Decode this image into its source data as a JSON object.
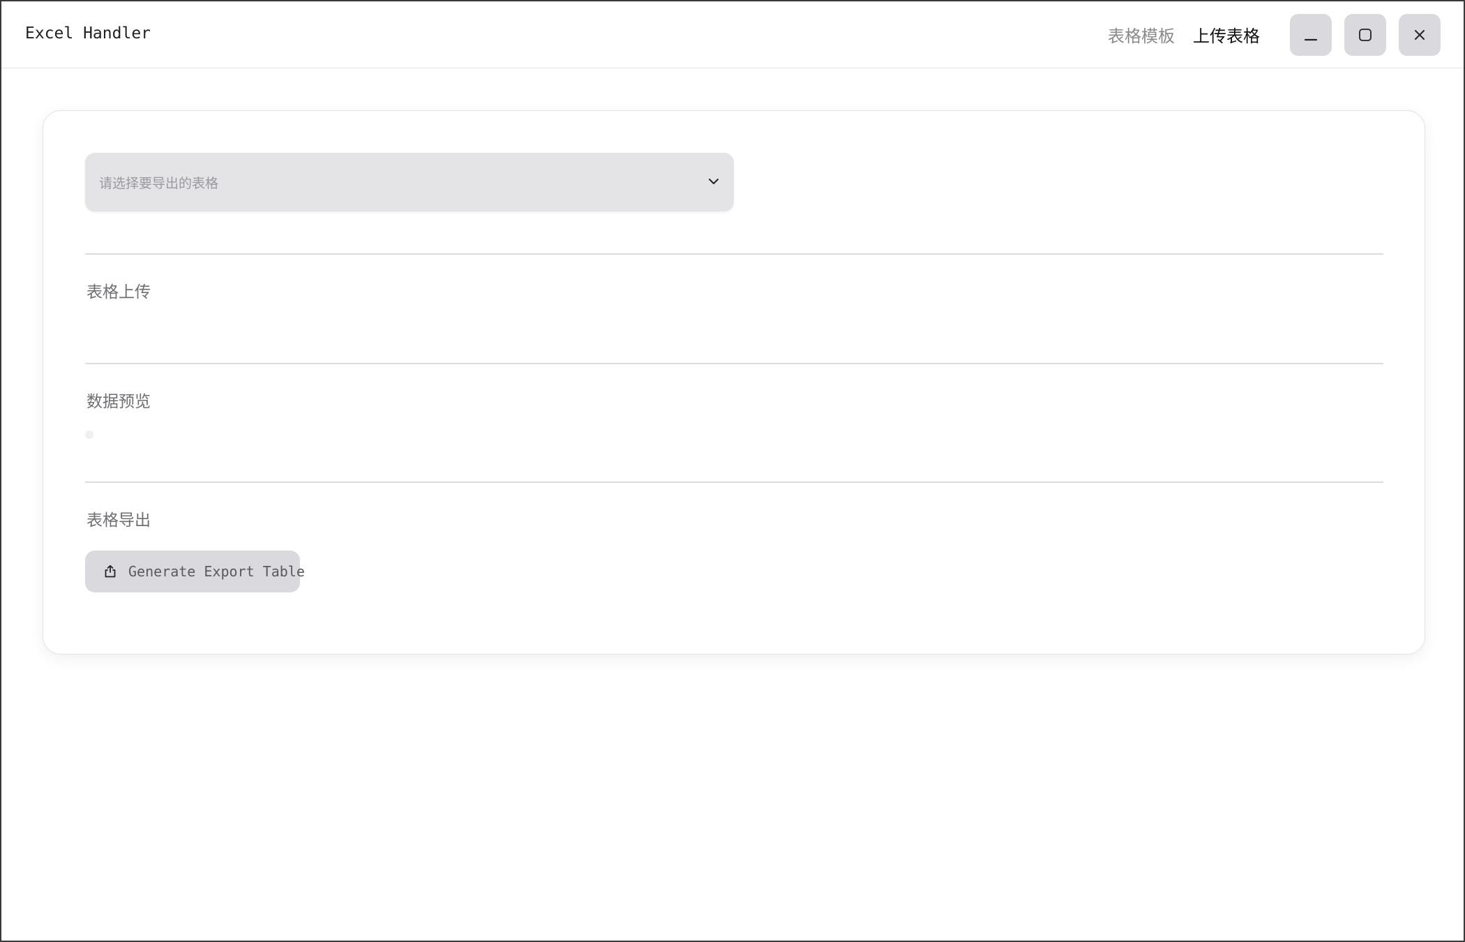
{
  "window": {
    "title": "Excel Handler",
    "nav": [
      {
        "label": "表格模板",
        "active": false
      },
      {
        "label": "上传表格",
        "active": true
      }
    ],
    "controls": {
      "minimize_icon": "minimize-icon",
      "maximize_icon": "maximize-icon",
      "close_icon": "close-icon"
    }
  },
  "main": {
    "table_select": {
      "placeholder": "请选择要导出的表格",
      "icon": "chevron-down-icon"
    },
    "sections": {
      "upload": {
        "label": "表格上传"
      },
      "preview": {
        "label": "数据预览"
      },
      "export": {
        "label": "表格导出",
        "button_label": "Generate Export Table",
        "button_icon": "share-export-icon"
      }
    }
  },
  "colors": {
    "button_bg": "#d9d9de",
    "select_bg": "#e4e4e7",
    "nav_active": "#111111",
    "nav_inactive": "#8a8a8a"
  }
}
